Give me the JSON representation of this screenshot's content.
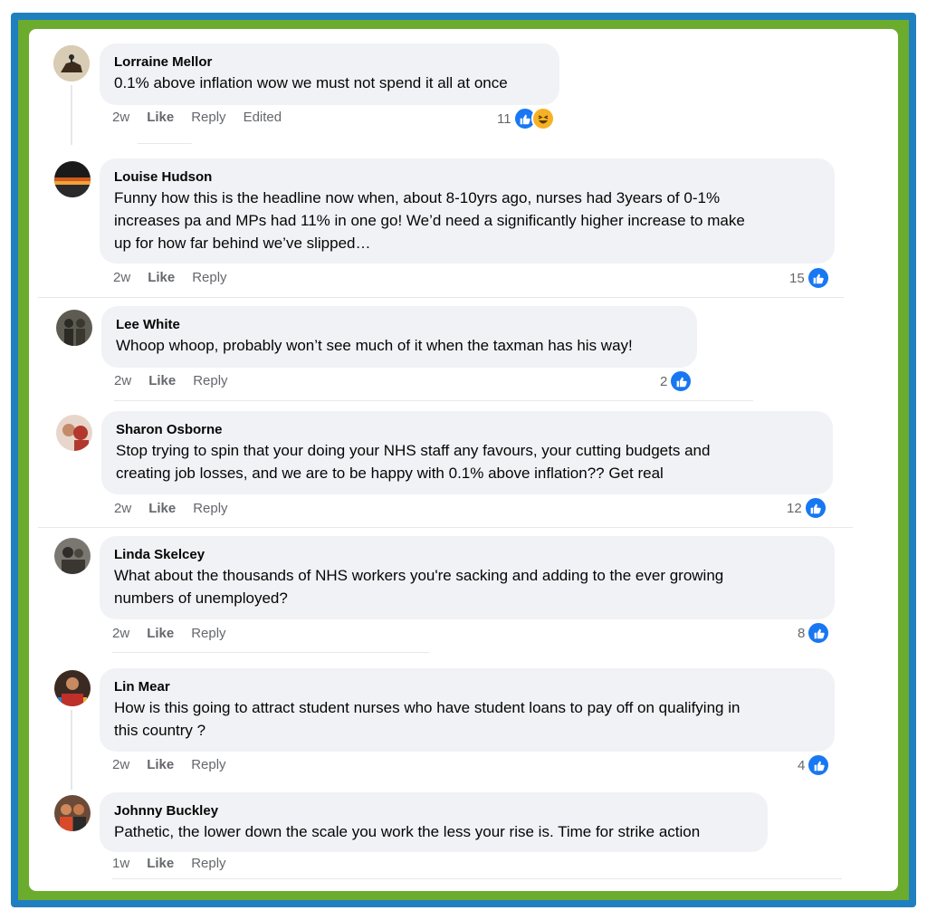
{
  "comments": [
    {
      "author": "Lorraine Mellor",
      "lines": [
        "0.1% above inflation wow we must not spend it all at once"
      ],
      "time": "2w",
      "like": "Like",
      "reply": "Reply",
      "edited": "Edited",
      "reactions": "11",
      "reaction_icons": [
        "like-icon",
        "haha-icon"
      ]
    },
    {
      "author": "Louise Hudson",
      "lines": [
        "Funny how this is the headline now when, about 8-10yrs ago, nurses had 3years of 0-1%",
        "increases pa and MPs had 11% in one go! We’d need a significantly higher increase to make",
        "up for how far behind we’ve slipped…"
      ],
      "time": "2w",
      "like": "Like",
      "reply": "Reply",
      "reactions": "15",
      "reaction_icons": [
        "like-icon"
      ]
    },
    {
      "author": "Lee White",
      "lines": [
        "Whoop whoop, probably won’t see much of it when the taxman has his way!"
      ],
      "time": "2w",
      "like": "Like",
      "reply": "Reply",
      "reactions": "2",
      "reaction_icons": [
        "like-icon"
      ]
    },
    {
      "author": "Sharon Osborne",
      "lines": [
        "Stop trying to spin that your doing your NHS staff any favours, your cutting budgets and",
        "creating job losses, and we are to be happy with 0.1% above inflation?? Get real"
      ],
      "time": "2w",
      "like": "Like",
      "reply": "Reply",
      "reactions": "12",
      "reaction_icons": [
        "like-icon"
      ]
    },
    {
      "author": "Linda Skelcey",
      "lines": [
        "What about the thousands of NHS workers you're sacking and adding to the ever growing",
        "numbers of unemployed?"
      ],
      "time": "2w",
      "like": "Like",
      "reply": "Reply",
      "reactions": "8",
      "reaction_icons": [
        "like-icon"
      ]
    },
    {
      "author": "Lin Mear",
      "lines": [
        "How is this going to attract student nurses who have student loans to pay off on qualifying in",
        "this country ?"
      ],
      "time": "2w",
      "like": "Like",
      "reply": "Reply",
      "reactions": "4",
      "reaction_icons": [
        "like-icon"
      ]
    },
    {
      "author": "Johnny Buckley",
      "lines": [
        "Pathetic, the lower down the scale you work the less your rise is. Time for strike action"
      ],
      "time": "1w",
      "like": "Like",
      "reply": "Reply"
    }
  ],
  "colors": {
    "frame_blue": "#1f7fbf",
    "frame_green": "#6bac2e",
    "bubble": "#f0f2f5",
    "like_blue": "#1877f2",
    "meta_gray": "#65676b"
  }
}
